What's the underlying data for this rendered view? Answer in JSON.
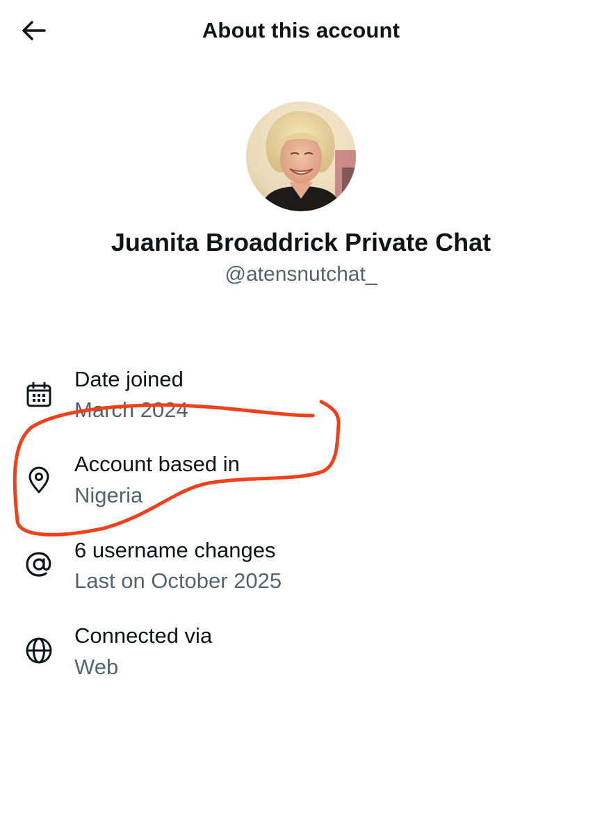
{
  "header": {
    "title": "About this account",
    "back_icon": "arrow-left-icon"
  },
  "profile": {
    "name": "Juanita Broaddrick Private Chat",
    "handle": "@atensnutchat_"
  },
  "info_rows": [
    {
      "icon": "calendar-icon",
      "label": "Date joined",
      "value": "March 2024"
    },
    {
      "icon": "location-pin-icon",
      "label": "Account based in",
      "value": "Nigeria"
    },
    {
      "icon": "at-sign-icon",
      "label": "6 username changes",
      "value": "Last on October 2025"
    },
    {
      "icon": "globe-icon",
      "label": "Connected via",
      "value": "Web"
    }
  ],
  "colors": {
    "primary_text": "#0f1419",
    "secondary_text": "#536471",
    "annotation": "#f0401c"
  }
}
